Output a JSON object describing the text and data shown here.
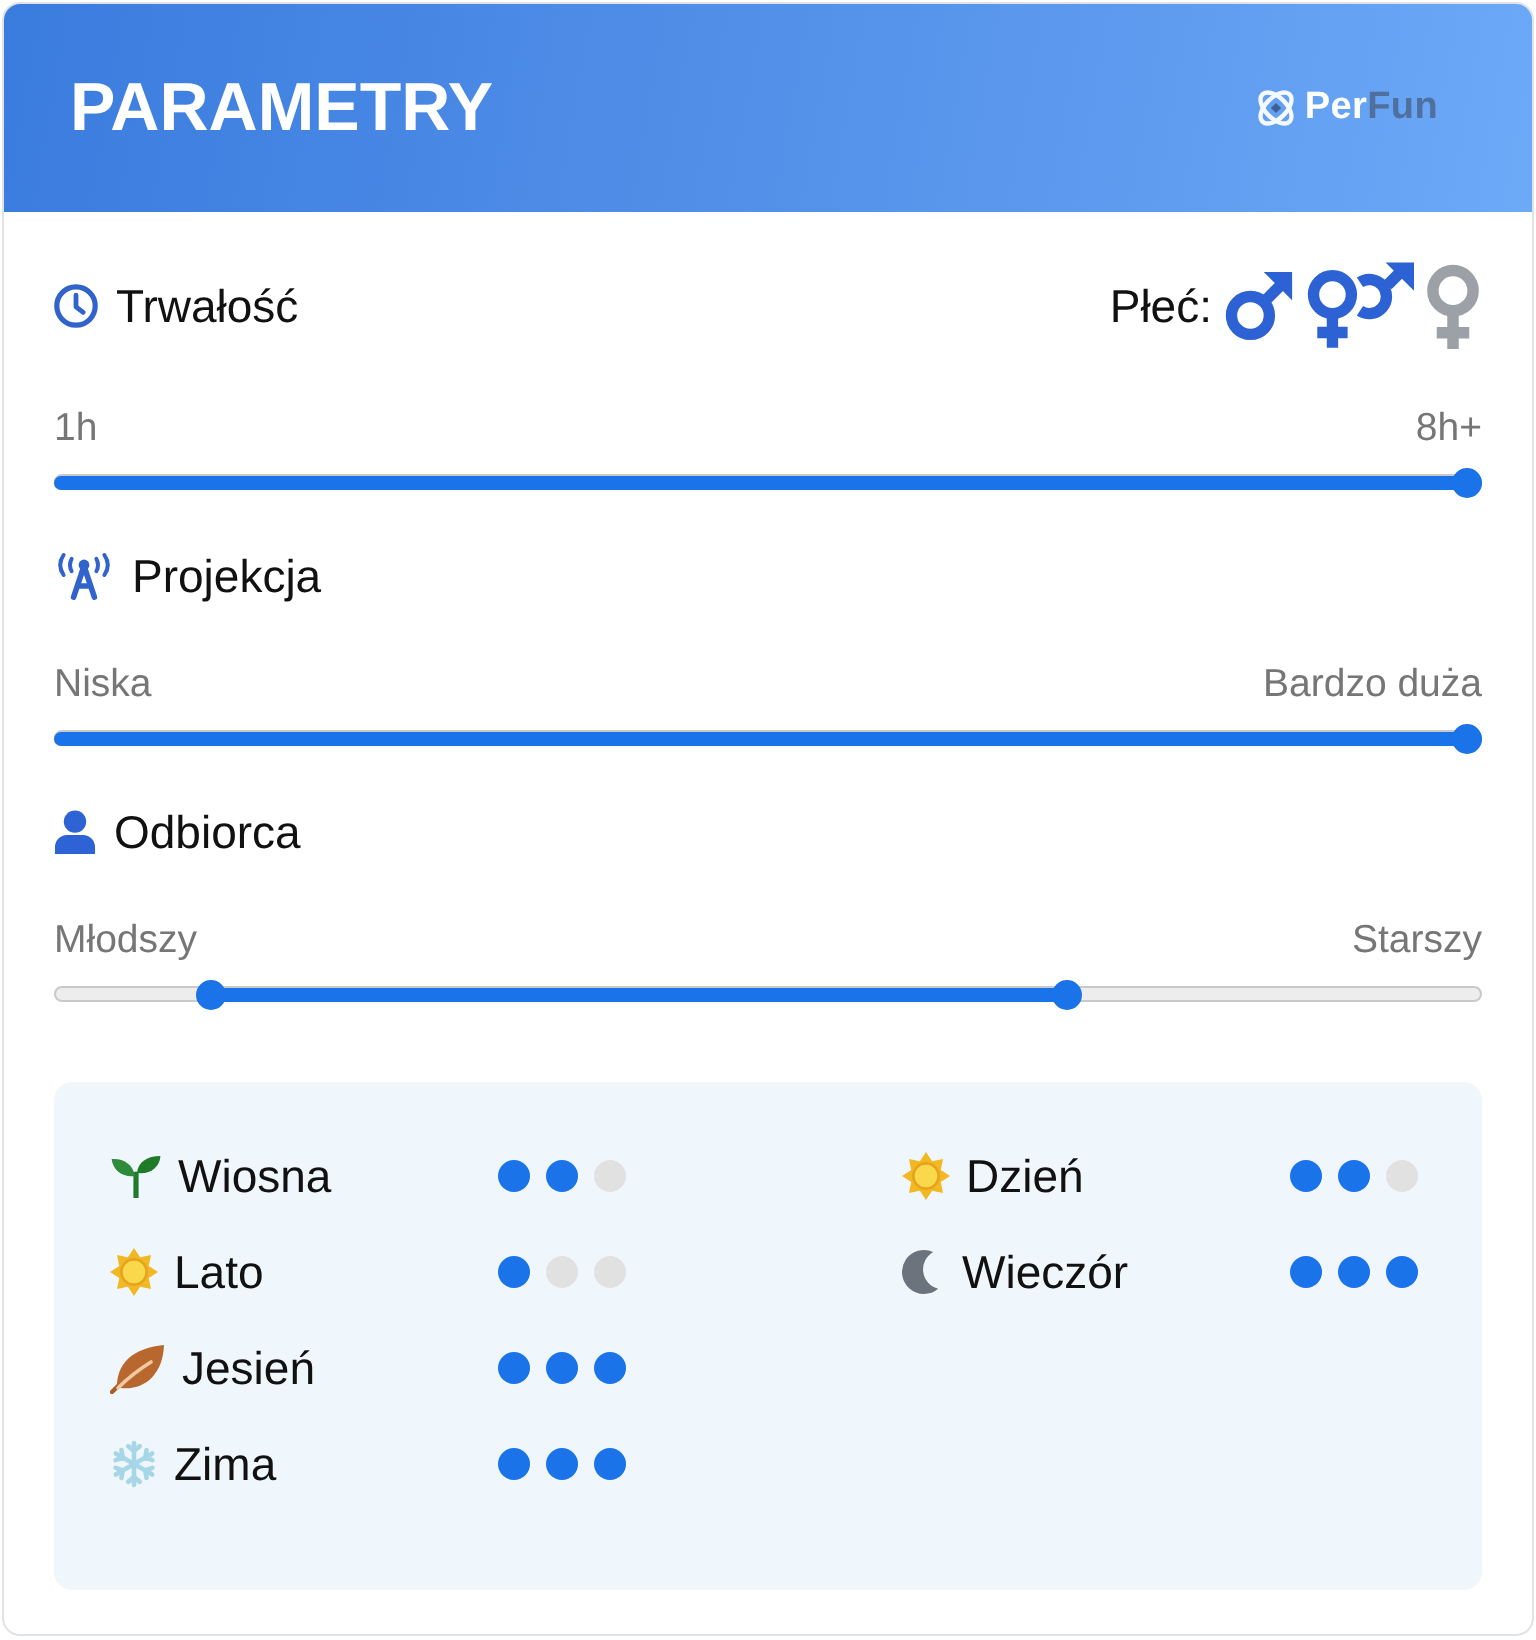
{
  "header": {
    "title": "PARAMETRY",
    "logo": {
      "part_1": "Per",
      "part_2": "Fun"
    }
  },
  "duration": {
    "title": "Trwałość",
    "gender": {
      "label": "Płeć:",
      "options": [
        {
          "kind": "male",
          "selected": true
        },
        {
          "kind": "male_female",
          "selected": true
        },
        {
          "kind": "female",
          "selected": false
        }
      ]
    },
    "slider": {
      "min_label": "1h",
      "max_label": "8h+",
      "level": 1
    }
  },
  "projection": {
    "title": "Projekcja",
    "slider": {
      "min_label": "Niska",
      "max_label": "Bardzo duża",
      "level": 1
    }
  },
  "audience": {
    "title": "Odbiorca",
    "slider": {
      "min_label": "Młodszy",
      "max_label": "Starszy",
      "thumbs": [
        {
          "level": 0.11
        },
        {
          "level": 0.71
        }
      ]
    }
  },
  "seasons": [
    {
      "kind": "spring",
      "label": "Wiosna",
      "stars": 2
    },
    {
      "kind": "summer",
      "label": "Lato",
      "stars": 1
    },
    {
      "kind": "autumn",
      "label": "Jesień",
      "stars": 3
    },
    {
      "kind": "winter",
      "label": "Zima",
      "stars": 3
    }
  ],
  "times_of_day": [
    {
      "kind": "day",
      "label": "Dzień",
      "stars": 2
    },
    {
      "kind": "evening",
      "label": "Wieczór",
      "stars": 3
    }
  ]
}
